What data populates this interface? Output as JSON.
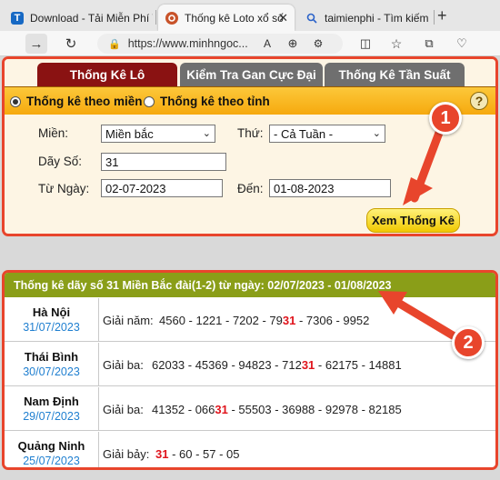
{
  "browser": {
    "tabs": [
      {
        "label": "Download - Tải Miễn Phí VN -",
        "icon": "T",
        "active": false
      },
      {
        "label": "Thống kê Loto xổ số",
        "icon": "",
        "active": true
      },
      {
        "label": "taimienphi - Tìm kiếm",
        "icon": "",
        "active": false
      }
    ],
    "url": "https://www.minhngoc..."
  },
  "form": {
    "tabs": [
      "Thống Kê Lô",
      "Kiểm Tra Gan Cực Đại",
      "Thống Kê Tần Suất"
    ],
    "modes": [
      "Thống kê theo miền",
      "Thống kê theo tỉnh"
    ],
    "help": "?",
    "region_label": "Miền:",
    "region_value": "Miền bắc",
    "weekday_label": "Thứ:",
    "weekday_value": "- Cả Tuần -",
    "numbers_label": "Dãy Số:",
    "numbers_value": "31",
    "from_label": "Từ Ngày:",
    "from_value": "02-07-2023",
    "to_label": "Đến:",
    "to_value": "01-08-2023",
    "submit_label": "Xem Thống Kê"
  },
  "results": {
    "title": "Thống kê dãy số 31 Miền Bắc đài(1-2) từ ngày: 02/07/2023 - 01/08/2023",
    "rows": [
      {
        "province": "Hà Nội",
        "date": "31/07/2023",
        "prize": "Giải năm:",
        "pre": "4560 - 1221 - 7202 - 79",
        "hit": "31",
        "post": " - 7306 - 9952"
      },
      {
        "province": "Thái Bình",
        "date": "30/07/2023",
        "prize": "Giải ba:",
        "pre": "62033 - 45369 - 94823 - 712",
        "hit": "31",
        "post": " - 62175 - 14881"
      },
      {
        "province": "Nam Định",
        "date": "29/07/2023",
        "prize": "Giải ba:",
        "pre": "41352 - 066",
        "hit": "31",
        "post": " - 55503 - 36988 - 92978 - 82185"
      },
      {
        "province": "Quảng Ninh",
        "date": "25/07/2023",
        "prize": "Giải bảy:",
        "pre": "",
        "hit": "31",
        "post": " - 60 - 57 - 05"
      }
    ]
  },
  "annotations": {
    "step1": "1",
    "step2": "2",
    "color": "#e8452c"
  }
}
